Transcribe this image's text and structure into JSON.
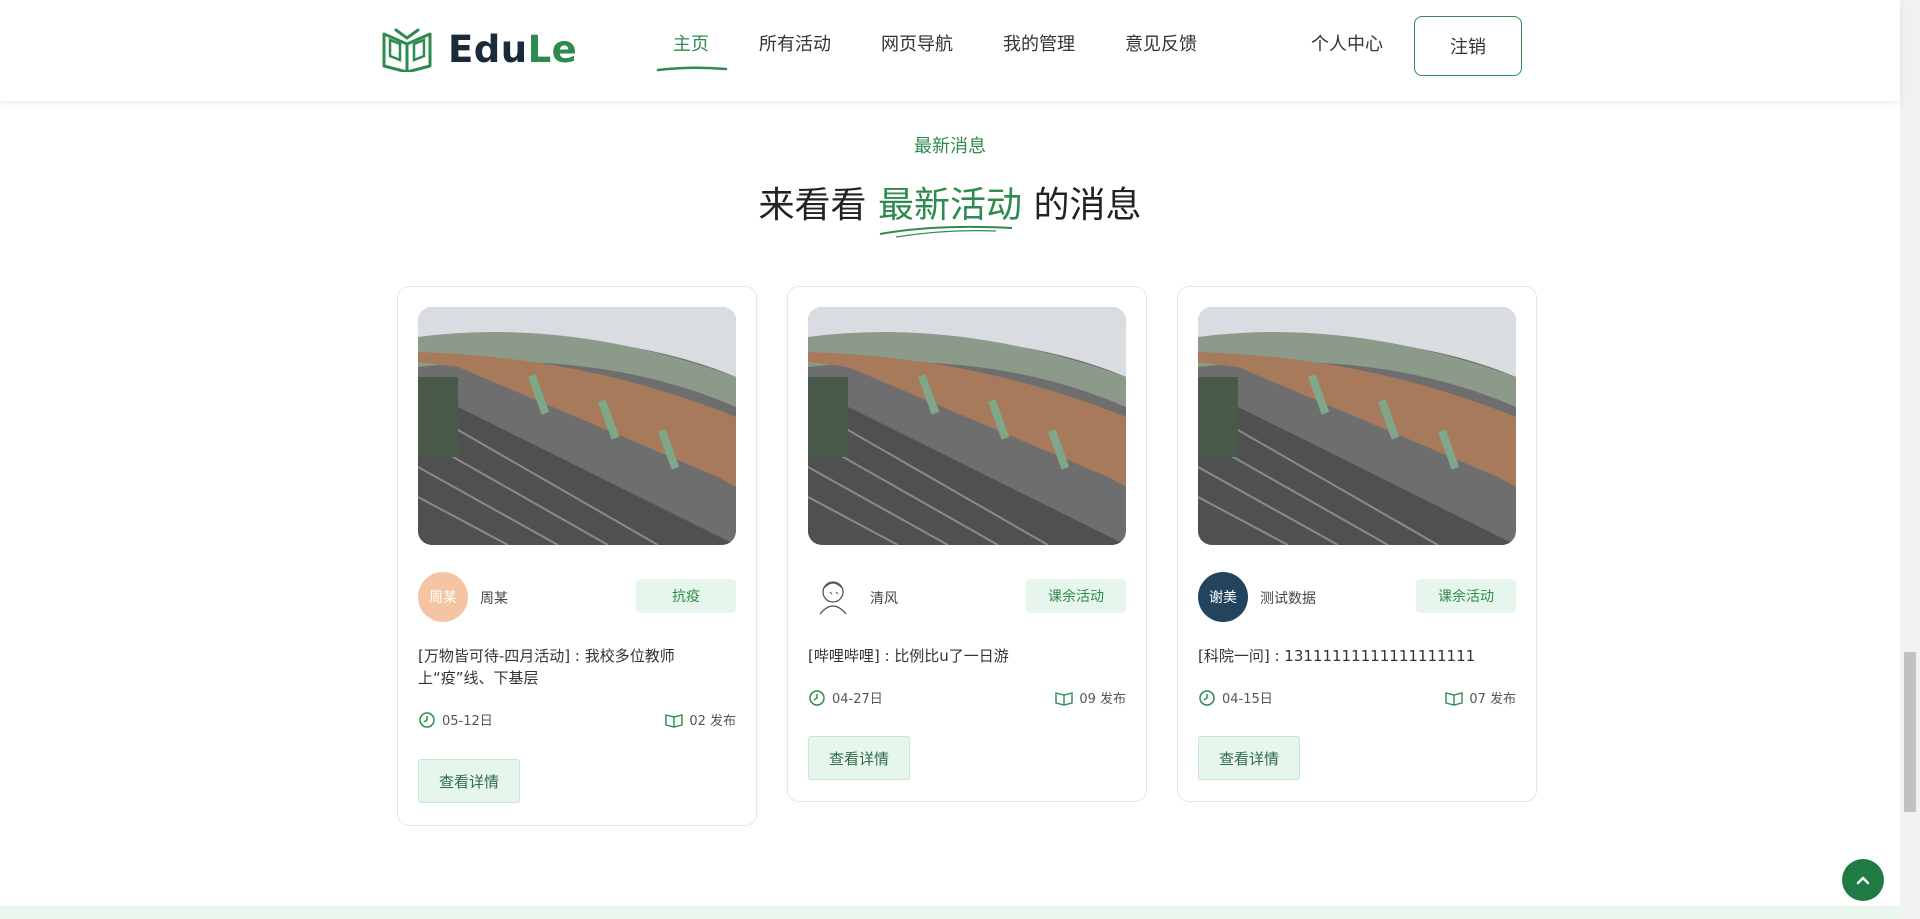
{
  "header": {
    "logo": {
      "prefix": "Edu",
      "suffix": "Le"
    },
    "nav": [
      {
        "label": "主页",
        "active": true
      },
      {
        "label": "所有活动",
        "active": false
      },
      {
        "label": "网页导航",
        "active": false
      },
      {
        "label": "我的管理",
        "active": false
      },
      {
        "label": "意见反馈",
        "active": false
      }
    ],
    "user_center": "个人中心",
    "logout": "注销"
  },
  "section": {
    "subtitle": "最新消息",
    "title_before": "来看看",
    "title_highlight": "最新活动",
    "title_after": "的消息"
  },
  "cards": [
    {
      "avatar_text": "周某",
      "avatar_color": "#f5c4a3",
      "author": "周某",
      "tag": "抗疫",
      "title_line1": "[万物皆可待-四月活动] : 我校多位教师",
      "title_line2": "上“疫”线、下基层",
      "date": "05-12日",
      "published": "02 发布",
      "button": "查看详情"
    },
    {
      "avatar_text": "",
      "avatar_icon": "sketch-avatar-icon",
      "author": "清风",
      "tag": "课余活动",
      "title_line1": "[哔哩哔哩] : 比例比u了一日游",
      "title_line2": "",
      "date": "04-27日",
      "published": "09 发布",
      "button": "查看详情"
    },
    {
      "avatar_text": "谢美",
      "avatar_color": "#22445f",
      "author": "测试数据",
      "tag": "课余活动",
      "title_line1": "[科院一问] : 13111111111111111111",
      "title_line2": "",
      "date": "04-15日",
      "published": "07 发布",
      "button": "查看详情"
    }
  ],
  "colors": {
    "accent": "#2e8b4e",
    "tag_bg": "#e6f6ec",
    "back_top": "#1f7a43"
  }
}
